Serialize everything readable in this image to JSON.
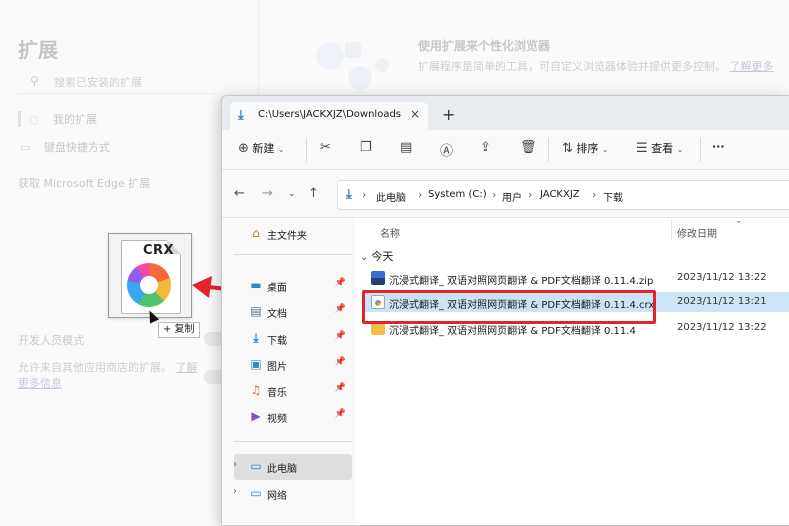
{
  "background_page": {
    "title": "扩展",
    "search_placeholder": "搜索已安装的扩展",
    "nav": [
      {
        "label": "我的扩展",
        "icon": "puzzle-icon"
      },
      {
        "label": "键盘快捷方式",
        "icon": "keyboard-icon"
      }
    ],
    "store_link": "获取 Microsoft Edge 扩展",
    "hero_title": "使用扩展来个性化浏览器",
    "hero_desc": "扩展程序是简单的工具，可自定义浏览器体验并提供更多控制。",
    "hero_link": "了解更多",
    "dev_mode_title": "开发人员模式",
    "other_store_desc": "允许来自其他应用商店的扩展。",
    "other_store_link": "了解更多信息"
  },
  "drag": {
    "file_label": "CRX",
    "tooltip": "+ 复制"
  },
  "explorer": {
    "tab_title": "C:\\Users\\JACKXJZ\\Downloads",
    "new_tab": "+",
    "close": "×",
    "toolbar": {
      "new_label": "新建",
      "sort_label": "排序",
      "view_label": "查看",
      "more_label": "···"
    },
    "breadcrumbs": [
      "此电脑",
      "System (C:)",
      "用户",
      "JACKXJZ",
      "下载"
    ],
    "sidebar": {
      "home": "主文件夹",
      "quick": [
        {
          "label": "桌面",
          "icon": "desktop-icon"
        },
        {
          "label": "文档",
          "icon": "document-icon"
        },
        {
          "label": "下载",
          "icon": "download-icon"
        },
        {
          "label": "图片",
          "icon": "picture-icon"
        },
        {
          "label": "音乐",
          "icon": "music-icon"
        },
        {
          "label": "视频",
          "icon": "video-icon"
        }
      ],
      "this_pc": "此电脑",
      "network": "网络"
    },
    "columns": {
      "name": "名称",
      "date": "修改日期"
    },
    "group_label": "今天",
    "files": [
      {
        "name": "沉浸式翻译_ 双语对照网页翻译 & PDF文档翻译 0.11.4.zip",
        "date": "2023/11/12 13:22",
        "type": "zip"
      },
      {
        "name": "沉浸式翻译_ 双语对照网页翻译 & PDF文档翻译 0.11.4.crx",
        "date": "2023/11/12 13:21",
        "type": "crx",
        "selected": true
      },
      {
        "name": "沉浸式翻译_ 双语对照网页翻译 & PDF文档翻译 0.11.4",
        "date": "2023/11/12 13:22",
        "type": "folder"
      }
    ]
  },
  "colors": {
    "highlight": "#e0252b",
    "selection": "#cce4f7",
    "accent": "#2f7fd0"
  }
}
